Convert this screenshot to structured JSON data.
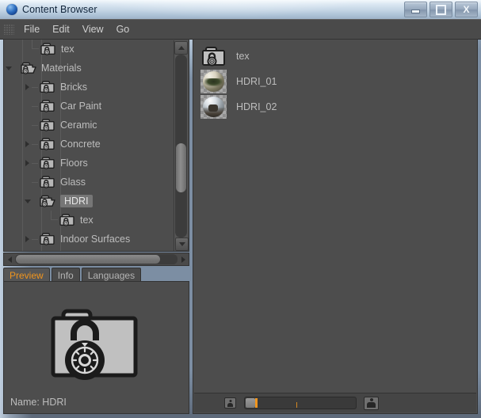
{
  "window": {
    "title": "Content Browser",
    "icon": "blue-sphere-icon",
    "buttons": {
      "minimize": "minimize-button",
      "maximize": "maximize-button",
      "close": "close-button",
      "close_glyph": "X"
    }
  },
  "menubar": {
    "grip": "drag-grip",
    "items": [
      {
        "label": "File"
      },
      {
        "label": "Edit"
      },
      {
        "label": "View"
      },
      {
        "label": "Go"
      }
    ]
  },
  "toolbar": {
    "group_left": [
      {
        "name": "content-disc-icon",
        "title": "Content"
      },
      {
        "name": "home-icon",
        "title": "Home"
      },
      {
        "name": "trash-icon",
        "title": "Trash"
      },
      {
        "name": "book-icon",
        "title": "Library"
      },
      {
        "name": "star-icon",
        "title": "Favorites"
      }
    ],
    "group_right": [
      {
        "name": "back-arrow-icon",
        "title": "Back",
        "enabled": true
      },
      {
        "name": "forward-arrow-icon",
        "title": "Forward",
        "enabled": false
      },
      {
        "name": "up-arrow-icon",
        "title": "Up",
        "enabled": true
      },
      {
        "name": "search-icon",
        "title": "Search",
        "enabled": true
      },
      {
        "name": "plus-icon",
        "title": "New",
        "enabled": true
      }
    ]
  },
  "tree": {
    "rows": [
      {
        "label": "tex",
        "indent": 3,
        "twisty": "none",
        "icon": "folder-locked-icon",
        "connector": "elbow",
        "selected": false
      },
      {
        "label": "Materials",
        "indent": 2,
        "twisty": "down",
        "icon": "folder-open-locked-icon",
        "connector": "none",
        "selected": false
      },
      {
        "label": "Bricks",
        "indent": 3,
        "twisty": "right",
        "icon": "folder-locked-icon",
        "connector": "dash",
        "selected": false
      },
      {
        "label": "Car Paint",
        "indent": 3,
        "twisty": "none",
        "icon": "folder-locked-icon",
        "connector": "dash",
        "selected": false
      },
      {
        "label": "Ceramic",
        "indent": 3,
        "twisty": "none",
        "icon": "folder-locked-icon",
        "connector": "dash",
        "selected": false
      },
      {
        "label": "Concrete",
        "indent": 3,
        "twisty": "right",
        "icon": "folder-locked-icon",
        "connector": "dash",
        "selected": false
      },
      {
        "label": "Floors",
        "indent": 3,
        "twisty": "right",
        "icon": "folder-locked-icon",
        "connector": "dash",
        "selected": false
      },
      {
        "label": "Glass",
        "indent": 3,
        "twisty": "none",
        "icon": "folder-locked-icon",
        "connector": "dash",
        "selected": false
      },
      {
        "label": "HDRI",
        "indent": 3,
        "twisty": "down",
        "icon": "folder-open-locked-icon",
        "connector": "none",
        "selected": true
      },
      {
        "label": "tex",
        "indent": 4,
        "twisty": "none",
        "icon": "folder-locked-icon",
        "connector": "elbow",
        "selected": false
      },
      {
        "label": "Indoor Surfaces",
        "indent": 3,
        "twisty": "right",
        "icon": "folder-locked-icon",
        "connector": "dash",
        "selected": false
      }
    ],
    "vertical_scrollbar": {
      "name": "tree-vertical-scrollbar",
      "thumb_top_pct": 42,
      "thumb_height_pct": 23
    },
    "horizontal_scrollbar": {
      "name": "tree-horizontal-scrollbar",
      "thumb_width_pct": 88
    }
  },
  "tabs": [
    {
      "label": "Preview",
      "active": true
    },
    {
      "label": "Info",
      "active": false
    },
    {
      "label": "Languages",
      "active": false
    }
  ],
  "preview": {
    "icon": "folder-locked-large-icon",
    "name_label": "Name: HDRI"
  },
  "filelist": {
    "items": [
      {
        "label": "tex",
        "icon": "folder-locked-icon",
        "thumb": "folder"
      },
      {
        "label": "HDRI_01",
        "icon": "hdri-sphere-preview",
        "thumb": "sphere-forest"
      },
      {
        "label": "HDRI_02",
        "icon": "hdri-sphere-preview",
        "thumb": "sphere-indoor"
      }
    ]
  },
  "statusbar": {
    "small_thumb_icon": "small-thumbnail-icon",
    "large_thumb_icon": "large-thumbnail-icon",
    "slider": {
      "name": "thumbnail-size-slider",
      "marker_color": "#f0951e"
    }
  },
  "colors": {
    "panel": "#4d4d4d",
    "chrome": "#4a4a4a",
    "text": "#bdbdbd",
    "accent": "#f0951e",
    "selection": "#767676",
    "border": "#333333"
  }
}
